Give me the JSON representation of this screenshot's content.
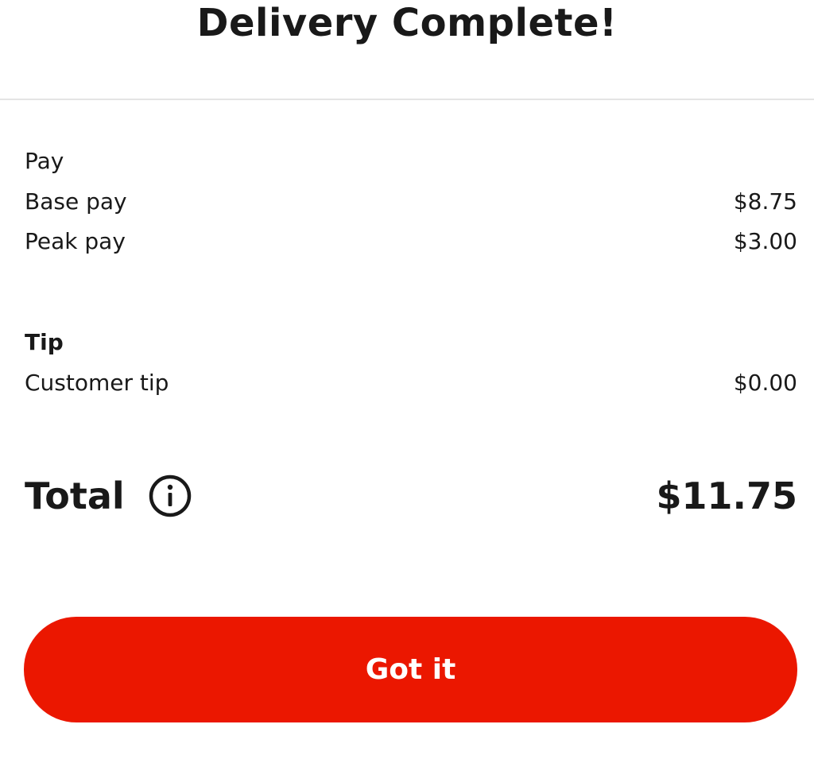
{
  "header": {
    "title": "Delivery Complete!"
  },
  "pay": {
    "heading": "Pay",
    "items": [
      {
        "label": "Base pay",
        "value": "$8.75"
      },
      {
        "label": "Peak pay",
        "value": "$3.00"
      }
    ]
  },
  "tip": {
    "heading": "Tip",
    "items": [
      {
        "label": "Customer tip",
        "value": "$0.00"
      }
    ]
  },
  "total": {
    "label": "Total",
    "info_icon": "info-circle-icon",
    "value": "$11.75"
  },
  "actions": {
    "confirm_label": "Got it"
  },
  "colors": {
    "accent": "#eb1700",
    "text": "#191919",
    "divider": "#e4e4e4"
  }
}
